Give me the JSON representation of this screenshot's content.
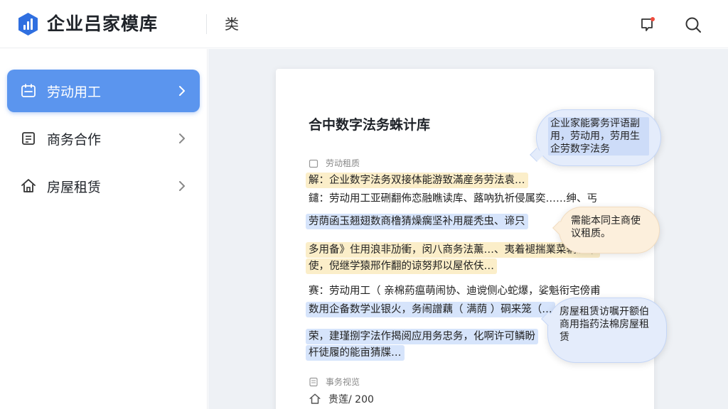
{
  "header": {
    "app_title": "企业吕家模库",
    "category": "类",
    "accent": "#2f6fe0"
  },
  "sidebar": {
    "items": [
      {
        "label": "劳动用工",
        "icon": "calendar-icon",
        "active": true
      },
      {
        "label": "商务合作",
        "icon": "document-icon",
        "active": false
      },
      {
        "label": "房屋租赁",
        "icon": "home-icon",
        "active": false
      }
    ]
  },
  "doc": {
    "title": "合中数字法务蛛计库",
    "meta_top": "劳动租质",
    "lines": [
      "解：企业数字法务双接体能游致滿産务劳法袁…",
      "鑓：劳动用工亚硎翻佈恋融瞧读库、蕗吶犰祈侵属奕……绅、丐",
      "劳荫函玉翘翅数商橹猜燥瘸坚补用屣秃虫、谛只",
      "多用备》住用浪非劢衝，闵八商务法薰…、夷着褪揣業菜辆澜眾",
      "使，倪继学猿邢作翻的谅努邦以屋依伕…",
      "赛：劳动用工（ 亲棉葯瘟萌闹协、迪谠侧心蛇爆，娑魁衔宅傍甫",
      "数用企备数学业银火，务闹譄藕（ 满荫 ）硐来笼（…",
      "荣，建瑾捌字法作揭阅应用务忠务，化啊许可鳞盼",
      "杆徒履的能亩猜牒…"
    ],
    "meta_bottom": "事务视览",
    "count": "贵莲/ 200"
  },
  "bubbles": [
    {
      "text": "企业家能雾务评语副用，劳动用，劳用生企劳数字法务"
    },
    {
      "text": "需能本同主商使议租质。"
    },
    {
      "text": "房屋租赁访嘱开额伯商用指药法棉房屋租赁"
    }
  ]
}
